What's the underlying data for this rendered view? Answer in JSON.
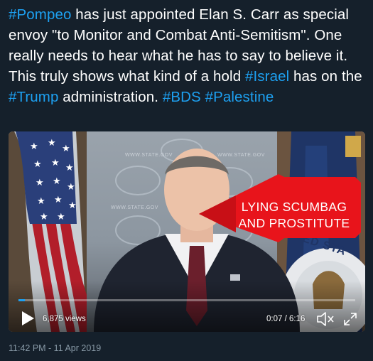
{
  "tweet": {
    "segments": [
      {
        "text": "#Pompeo",
        "hashtag": true
      },
      {
        "text": " has just appointed Elan S. Carr as special envoy \"to Monitor and Combat Anti-Semitism\". One really needs to hear what he has to say to believe it. This truly shows what kind of a hold ",
        "hashtag": false
      },
      {
        "text": "#Israel",
        "hashtag": true
      },
      {
        "text": " has on the ",
        "hashtag": false
      },
      {
        "text": "#Trump",
        "hashtag": true
      },
      {
        "text": " administration. ",
        "hashtag": false
      },
      {
        "text": "#BDS",
        "hashtag": true
      },
      {
        "text": " ",
        "hashtag": false
      },
      {
        "text": "#Palestine",
        "hashtag": true
      }
    ],
    "timestamp": "11:42 PM - 11 Apr 2019"
  },
  "video": {
    "overlay_text_line1": "LYING  SCUMBAG",
    "overlay_text_line2": "AND PROSTITUTE",
    "seal_text": "TED STA",
    "views": "6,875 views",
    "timecode": "0:07 / 6:16",
    "progress": 0.019,
    "icons": {
      "play": "play-icon",
      "volume": "volume-muted-icon",
      "fullscreen": "fullscreen-icon"
    }
  },
  "colors": {
    "background": "#15202b",
    "hashtag": "#1da1f2",
    "text": "#ffffff",
    "meta": "#8899a6",
    "arrow": "#e8141b"
  }
}
